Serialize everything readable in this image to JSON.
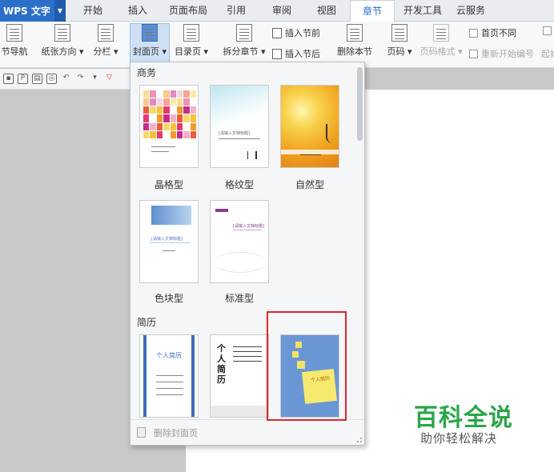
{
  "app": {
    "title": "WPS 文字"
  },
  "tabs": [
    "开始",
    "插入",
    "页面布局",
    "引用",
    "审阅",
    "视图",
    "章节",
    "开发工具",
    "云服务"
  ],
  "active_tab": "章节",
  "ribbon": {
    "section_nav": "节导航",
    "orientation": "纸张方向",
    "columns": "分栏",
    "cover": "封面页",
    "toc": "目录页",
    "split_section": "拆分章节",
    "insert_before": "插入节前",
    "insert_after": "插入节后",
    "delete_section": "删除本节",
    "page_number": "页码",
    "page_number_format": "页码格式",
    "first_page_diff": "首页不同",
    "restart_numbering": "重新开始编号",
    "start_truncated": "起始"
  },
  "panel": {
    "sections": [
      {
        "title": "商务",
        "items": [
          "晶格型",
          "格纹型",
          "自然型",
          "色块型",
          "标准型"
        ]
      },
      {
        "title": "简历",
        "items": [
          "",
          "",
          ""
        ]
      }
    ],
    "thumb_text": {
      "grid_title": "请输入文档标题",
      "doc_title_bracket": "[请输入文档标题]",
      "resume_1": "个人简历",
      "resume_2": "个人简历",
      "resume_3": "个人简历"
    },
    "footer": "删除封面页"
  },
  "watermark": {
    "title": "百科全说",
    "subtitle": "助你轻松解决"
  },
  "colors": {
    "accent": "#2c6fc9",
    "highlight": "#e1262b",
    "watermark": "#2aa64a"
  },
  "icons": [
    "dropdown-arrow-icon",
    "save-icon",
    "print-icon",
    "undo-icon",
    "redo-icon",
    "delete-cover-icon"
  ]
}
